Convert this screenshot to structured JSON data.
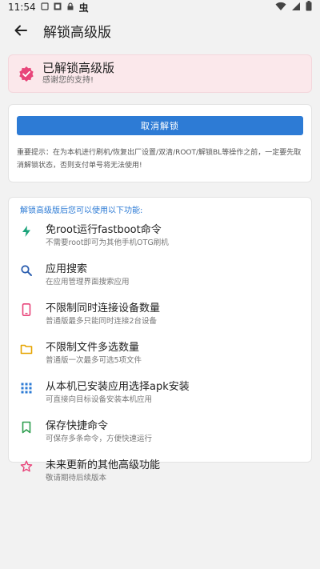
{
  "status": {
    "time": "11:54",
    "left_icons": [
      "bug-icon",
      "notification-icon",
      "cloud-icon",
      "lock-icon"
    ],
    "bug_glyph": "虫",
    "right_icons": [
      "wifi-icon",
      "signal-icon",
      "battery-icon"
    ]
  },
  "header": {
    "title": "解锁高级版"
  },
  "unlocked": {
    "title": "已解锁高级版",
    "subtitle": "感谢您的支持!"
  },
  "cancel": {
    "button_label": "取消解锁",
    "warning": "重要提示：在为本机进行刷机/恢复出厂设置/双清/ROOT/解锁BL等操作之前，一定要先取消解锁状态，否则支付单号将无法使用!"
  },
  "features": {
    "header": "解锁高级版后您可以使用以下功能:",
    "items": [
      {
        "title": "免root运行fastboot命令",
        "desc": "不需要root即可为其他手机OTG刷机",
        "icon": "lightning-icon",
        "color": "#1aa37a"
      },
      {
        "title": "应用搜索",
        "desc": "在应用管理界面搜索应用",
        "icon": "search-icon",
        "color": "#2d5fb0"
      },
      {
        "title": "不限制同时连接设备数量",
        "desc": "普通版最多只能同时连接2台设备",
        "icon": "phone-icon",
        "color": "#e8457a"
      },
      {
        "title": "不限制文件多选数量",
        "desc": "普通版一次最多可选5项文件",
        "icon": "folder-icon",
        "color": "#e6a400"
      },
      {
        "title": "从本机已安装应用选择apk安装",
        "desc": "可直接向目标设备安装本机应用",
        "icon": "apps-grid-icon",
        "color": "#2d7bd5"
      },
      {
        "title": "保存快捷命令",
        "desc": "可保存多条命令，方便快速运行",
        "icon": "bookmark-icon",
        "color": "#2e9e4f"
      },
      {
        "title": "未来更新的其他高级功能",
        "desc": "敬请期待后续版本",
        "icon": "star-icon",
        "color": "#e8457a"
      }
    ]
  }
}
